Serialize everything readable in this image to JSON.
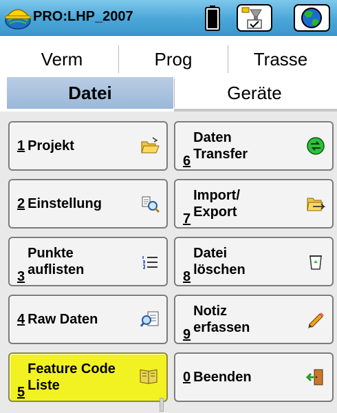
{
  "window": {
    "title": "PRO:LHP_2007",
    "logo_icon": "helmet-globe-icon",
    "battery_icon": "battery-icon",
    "gps_button_icon": "gps-receiver-icon",
    "globe_button_icon": "globe-icon"
  },
  "tabs": {
    "row1": [
      "Verm",
      "Prog",
      "Trasse"
    ],
    "row2": [
      {
        "label": "Datei",
        "active": true
      },
      {
        "label": "Geräte",
        "active": false
      }
    ]
  },
  "menu": {
    "left": [
      {
        "num": "1",
        "lines": [
          "Projekt"
        ],
        "icon": "folder-open-icon",
        "highlight": false
      },
      {
        "num": "2",
        "lines": [
          "Einstellung"
        ],
        "icon": "settings-magnifier-icon",
        "highlight": false
      },
      {
        "num": "3",
        "lines": [
          "Punkte",
          "auflisten"
        ],
        "icon": "numbered-list-icon",
        "highlight": false
      },
      {
        "num": "4",
        "lines": [
          "Raw Daten"
        ],
        "icon": "raw-data-icon",
        "highlight": false
      },
      {
        "num": "5",
        "lines": [
          "Feature Code",
          "Liste"
        ],
        "icon": "book-icon",
        "highlight": true
      }
    ],
    "right": [
      {
        "num": "6",
        "lines": [
          "Daten",
          "Transfer"
        ],
        "icon": "transfer-icon",
        "highlight": false
      },
      {
        "num": "7",
        "lines": [
          "Import/",
          "Export"
        ],
        "icon": "folder-import-icon",
        "highlight": false
      },
      {
        "num": "8",
        "lines": [
          "Datei",
          "löschen"
        ],
        "icon": "recycle-bin-icon",
        "highlight": false
      },
      {
        "num": "9",
        "lines": [
          "Notiz",
          "erfassen"
        ],
        "icon": "pencil-icon",
        "highlight": false
      },
      {
        "num": "0",
        "lines": [
          "Beenden"
        ],
        "icon": "exit-door-icon",
        "highlight": false
      }
    ]
  },
  "colors": {
    "titlebar": "#4aa6d8",
    "active_tab": "#9bb8d9",
    "highlight": "#f2f222"
  }
}
